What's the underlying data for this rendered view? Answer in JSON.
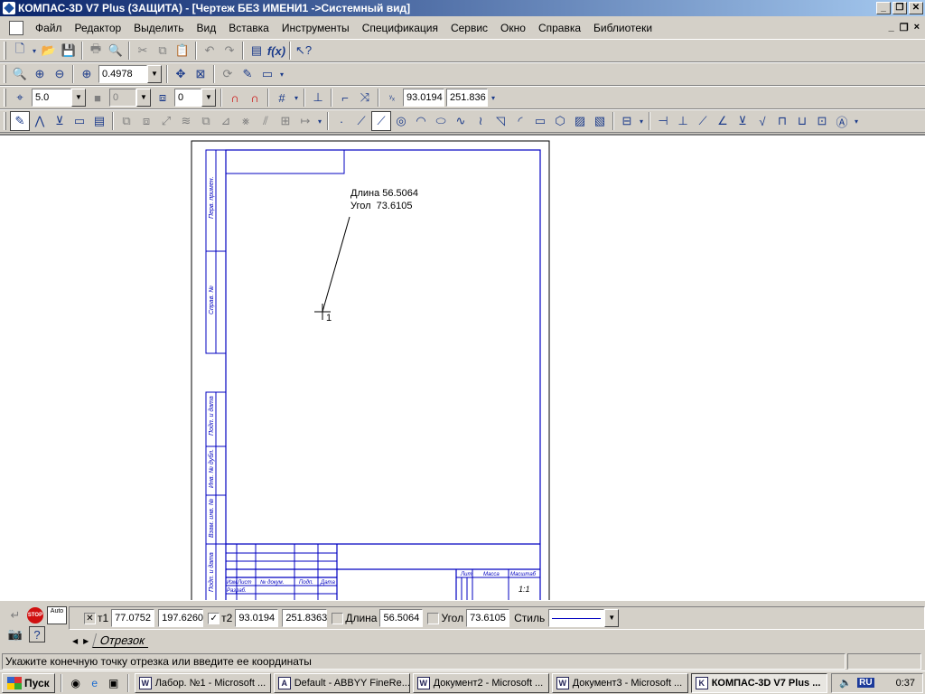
{
  "window": {
    "title": "КОМПАС-3D V7 Plus (ЗАЩИТА) - [Чертеж БЕЗ ИМЕНИ1 ->Системный вид]",
    "btn_minimize": "_",
    "btn_restore": "❐",
    "btn_close": "✕"
  },
  "menu": {
    "items": [
      "Файл",
      "Редактор",
      "Выделить",
      "Вид",
      "Вставка",
      "Инструменты",
      "Спецификация",
      "Сервис",
      "Окно",
      "Справка",
      "Библиотеки"
    ],
    "mdi_minimize": "_",
    "mdi_restore": "❐",
    "mdi_close": "×"
  },
  "toolbar_view": {
    "zoom_value": "0.4978"
  },
  "toolbar_params": {
    "step_value": "5.0",
    "layer_value": "0",
    "style_value": "0",
    "coord_x": "93.0194",
    "coord_y": "251.836"
  },
  "canvas": {
    "cursor_readout_length": "Длина 56.5064",
    "cursor_readout_angle": "Угол  73.6105",
    "snap_label": "1",
    "stamp_labels": {
      "side_1": "Перв. примен.",
      "side_2": "Справ. №",
      "side_3": "Подп. и дата",
      "side_4": "Инв. № дубл.",
      "side_5": "Взам. инв. №",
      "side_6": "Подп. и дата",
      "izm": "Изм",
      "list": "Лист",
      "ndokum": "№ докум.",
      "podp": "Подп.",
      "data": "Дата",
      "razrab": "Разраб.",
      "lit": "Лит.",
      "massa": "Масса",
      "masshtab": "Масштаб",
      "scale_value": "1:1"
    }
  },
  "properties": {
    "t1_label": "т1",
    "t1_x": "77.0752",
    "t1_y": "197.6260",
    "t2_label": "т2",
    "t2_x": "93.0194",
    "t2_y": "251.8363",
    "length_label": "Длина",
    "length_value": "56.5064",
    "angle_label": "Угол",
    "angle_value": "73.6105",
    "style_label": "Стиль",
    "tab_label": "Отрезок",
    "stop_label": "STOP",
    "auto_label": "Auto"
  },
  "status": {
    "message": "Укажите конечную точку отрезка или введите ее координаты"
  },
  "taskbar": {
    "start_label": "Пуск",
    "tasks": [
      {
        "label": "Лабор. №1 - Microsoft ...",
        "icon": "W"
      },
      {
        "label": "Default - ABBYY FineRe...",
        "icon": "A"
      },
      {
        "label": "Документ2 - Microsoft ...",
        "icon": "W"
      },
      {
        "label": "Документ3 - Microsoft ...",
        "icon": "W"
      },
      {
        "label": "КОМПАС-3D V7 Plus ...",
        "icon": "K"
      }
    ],
    "lang": "RU",
    "clock": "0:37"
  },
  "colors": {
    "frame_blue": "#0000c0",
    "title_start": "#0a246a",
    "title_end": "#a6caf0"
  }
}
